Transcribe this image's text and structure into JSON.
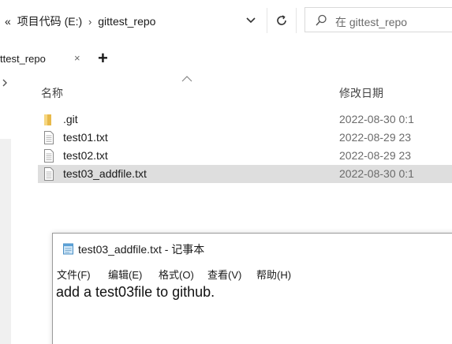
{
  "address_bar": {
    "overflow": "«",
    "drive": "项目代码 (E:)",
    "separator": "›",
    "folder": "gittest_repo"
  },
  "search": {
    "placeholder": "在 gittest_repo"
  },
  "tab": {
    "label": "ttest_repo",
    "close": "×",
    "add": "+"
  },
  "columns": {
    "name": "名称",
    "date_modified": "修改日期"
  },
  "files": [
    {
      "name": ".git",
      "date": "2022-08-30 0:1",
      "type": "folder",
      "selected": false
    },
    {
      "name": "test01.txt",
      "date": "2022-08-29 23",
      "type": "text",
      "selected": false
    },
    {
      "name": "test02.txt",
      "date": "2022-08-29 23",
      "type": "text",
      "selected": false
    },
    {
      "name": "test03_addfile.txt",
      "date": "2022-08-30 0:1",
      "type": "text",
      "selected": true
    }
  ],
  "notepad": {
    "title": "test03_addfile.txt - 记事本",
    "menu": [
      "文件(F)",
      "编辑(E)",
      "格式(O)",
      "查看(V)",
      "帮助(H)"
    ],
    "content": "add a test03file to github."
  },
  "colors": {
    "folder": "#e8b94a",
    "selection": "#dedede",
    "accent": "#0078d7"
  }
}
